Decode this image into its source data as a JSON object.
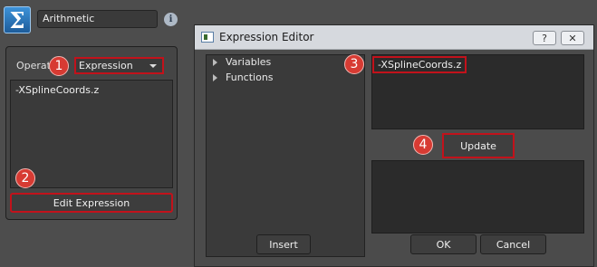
{
  "node": {
    "name": "Arithmetic",
    "app_icon_glyph": "Σ",
    "info_icon": "info-icon",
    "info_glyph": "i"
  },
  "operation": {
    "label": "Operat",
    "selected": "Expression"
  },
  "expression_text": "-XSplineCoords.z",
  "edit_expression_label": "Edit Expression",
  "callouts": [
    "1",
    "2",
    "3",
    "4"
  ],
  "dialog": {
    "title": "Expression Editor",
    "help_glyph": "?",
    "close_glyph": "✕",
    "tree": [
      "Variables",
      "Functions"
    ],
    "expression_text": "-XSplineCoords.z",
    "update_label": "Update",
    "insert_label": "Insert",
    "ok_label": "OK",
    "cancel_label": "Cancel"
  },
  "colors": {
    "highlight": "#c2121b",
    "callout": "#d73b33",
    "panel_bg": "#4d4d4d",
    "title_bar": "#d6d9de"
  }
}
